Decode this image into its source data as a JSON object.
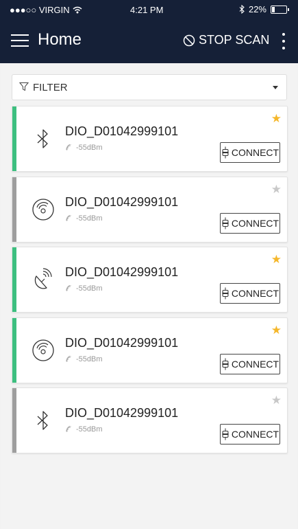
{
  "status_bar": {
    "carrier": "●●●○○ VIRGIN",
    "time": "4:21 PM",
    "battery": "22%",
    "battery_level": 0.22
  },
  "navbar": {
    "title": "Home",
    "stop_scan": "STOP SCAN",
    "menu_icon": "hamburger-icon",
    "more_icon": "kebab-icon"
  },
  "filter": {
    "label": "FILTER"
  },
  "colors": {
    "header": "#152037",
    "connectable": "#3dbf7f",
    "not_connectable": "#9e9e9e",
    "star_on": "#f5b72b",
    "star_off": "#c8c8c8"
  },
  "devices": [
    {
      "name": "DIO_D01042999101",
      "rssi": "-55dBm",
      "icon": "bluetooth-icon",
      "favorite": true,
      "bar": "connectable",
      "connect": "CONNECT"
    },
    {
      "name": "DIO_D01042999101",
      "rssi": "-55dBm",
      "icon": "radio-disc-icon",
      "favorite": false,
      "bar": "not_connectable",
      "connect": "CONNECT"
    },
    {
      "name": "DIO_D01042999101",
      "rssi": "-55dBm",
      "icon": "satellite-dish-icon",
      "favorite": true,
      "bar": "connectable",
      "connect": "CONNECT"
    },
    {
      "name": "DIO_D01042999101",
      "rssi": "-55dBm",
      "icon": "radio-disc-icon",
      "favorite": true,
      "bar": "connectable",
      "connect": "CONNECT"
    },
    {
      "name": "DIO_D01042999101",
      "rssi": "-55dBm",
      "icon": "bluetooth-icon",
      "favorite": false,
      "bar": "not_connectable",
      "connect": "CONNECT"
    }
  ]
}
